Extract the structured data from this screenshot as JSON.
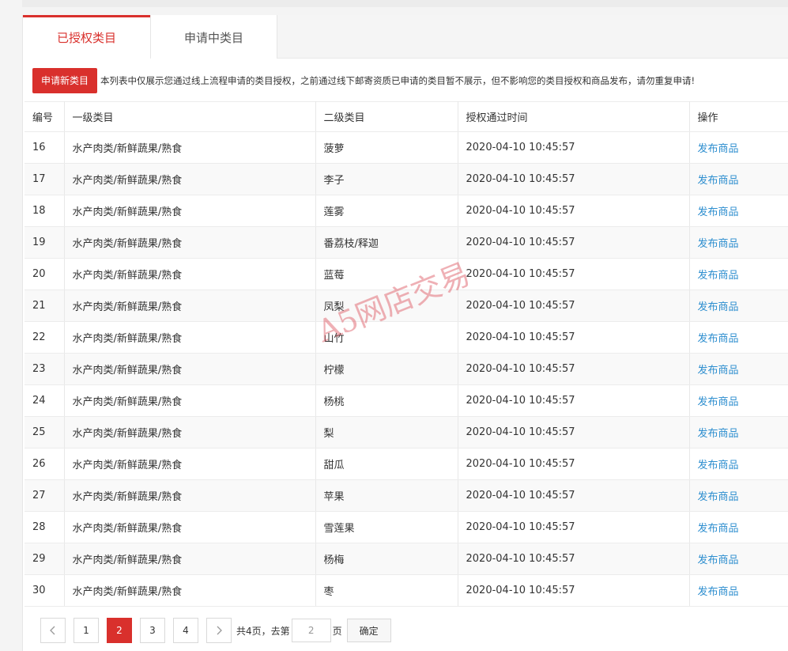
{
  "tabs": [
    {
      "label": "已授权类目",
      "active": true
    },
    {
      "label": "申请中类目",
      "active": false
    }
  ],
  "notice": {
    "button_label": "申请新类目",
    "text": "本列表中仅展示您通过线上流程申请的类目授权，之前通过线下邮寄资质已申请的类目暂不展示，但不影响您的类目授权和商品发布，请勿重复申请!"
  },
  "table": {
    "headers": [
      "编号",
      "一级类目",
      "二级类目",
      "授权通过时间",
      "操作"
    ],
    "rows": [
      {
        "id": "16",
        "cat1": "水产肉类/新鲜蔬果/熟食",
        "cat2": "菠萝",
        "time": "2020-04-10 10:45:57",
        "action": "发布商品"
      },
      {
        "id": "17",
        "cat1": "水产肉类/新鲜蔬果/熟食",
        "cat2": "李子",
        "time": "2020-04-10 10:45:57",
        "action": "发布商品"
      },
      {
        "id": "18",
        "cat1": "水产肉类/新鲜蔬果/熟食",
        "cat2": "莲雾",
        "time": "2020-04-10 10:45:57",
        "action": "发布商品"
      },
      {
        "id": "19",
        "cat1": "水产肉类/新鲜蔬果/熟食",
        "cat2": "番荔枝/释迦",
        "time": "2020-04-10 10:45:57",
        "action": "发布商品"
      },
      {
        "id": "20",
        "cat1": "水产肉类/新鲜蔬果/熟食",
        "cat2": "蓝莓",
        "time": "2020-04-10 10:45:57",
        "action": "发布商品"
      },
      {
        "id": "21",
        "cat1": "水产肉类/新鲜蔬果/熟食",
        "cat2": "凤梨",
        "time": "2020-04-10 10:45:57",
        "action": "发布商品"
      },
      {
        "id": "22",
        "cat1": "水产肉类/新鲜蔬果/熟食",
        "cat2": "山竹",
        "time": "2020-04-10 10:45:57",
        "action": "发布商品"
      },
      {
        "id": "23",
        "cat1": "水产肉类/新鲜蔬果/熟食",
        "cat2": "柠檬",
        "time": "2020-04-10 10:45:57",
        "action": "发布商品"
      },
      {
        "id": "24",
        "cat1": "水产肉类/新鲜蔬果/熟食",
        "cat2": "杨桃",
        "time": "2020-04-10 10:45:57",
        "action": "发布商品"
      },
      {
        "id": "25",
        "cat1": "水产肉类/新鲜蔬果/熟食",
        "cat2": "梨",
        "time": "2020-04-10 10:45:57",
        "action": "发布商品"
      },
      {
        "id": "26",
        "cat1": "水产肉类/新鲜蔬果/熟食",
        "cat2": "甜瓜",
        "time": "2020-04-10 10:45:57",
        "action": "发布商品"
      },
      {
        "id": "27",
        "cat1": "水产肉类/新鲜蔬果/熟食",
        "cat2": "苹果",
        "time": "2020-04-10 10:45:57",
        "action": "发布商品"
      },
      {
        "id": "28",
        "cat1": "水产肉类/新鲜蔬果/熟食",
        "cat2": "雪莲果",
        "time": "2020-04-10 10:45:57",
        "action": "发布商品"
      },
      {
        "id": "29",
        "cat1": "水产肉类/新鲜蔬果/熟食",
        "cat2": "杨梅",
        "time": "2020-04-10 10:45:57",
        "action": "发布商品"
      },
      {
        "id": "30",
        "cat1": "水产肉类/新鲜蔬果/熟食",
        "cat2": "枣",
        "time": "2020-04-10 10:45:57",
        "action": "发布商品"
      }
    ]
  },
  "pagination": {
    "pages": [
      "1",
      "2",
      "3",
      "4"
    ],
    "current_page": "2",
    "total_text": "共4页，去第",
    "goto_value": "2",
    "page_suffix": "页",
    "confirm_label": "确定",
    "prev_icon": "chevron-left-icon",
    "next_icon": "chevron-right-icon"
  },
  "watermark": "A5网店交易",
  "colors": {
    "accent": "#d9302c",
    "link": "#2d8ecf"
  }
}
